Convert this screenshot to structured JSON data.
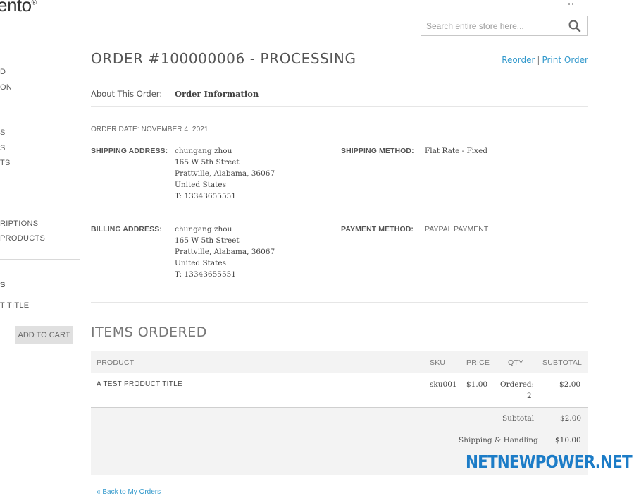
{
  "header": {
    "logo_text": "ento",
    "logo_mark": "®",
    "search": {
      "placeholder": "Search entire store here...",
      "icon": "search-icon"
    }
  },
  "sidebar": {
    "items_top": [
      "D",
      "ON"
    ],
    "items_mid": [
      "S",
      "S",
      "TS"
    ],
    "items_sub": [
      "RIPTIONS",
      "PRODUCTS"
    ],
    "recent_heading": "S",
    "recent_product": "T TITLE",
    "add_to_cart_label": "ADD TO CART"
  },
  "order": {
    "title": "ORDER #100000006 - PROCESSING",
    "reorder_label": "Reorder",
    "separator": "|",
    "print_label": "Print Order",
    "about_label": "About This Order:",
    "about_value": "Order Information",
    "order_date": "ORDER DATE: NOVEMBER 4, 2021",
    "shipping_address_label": "SHIPPING ADDRESS:",
    "shipping_address": [
      "chungang zhou",
      "165 W 5th Street",
      "Prattville, Alabama, 36067",
      "United States",
      "T: 13343655551"
    ],
    "shipping_method_label": "SHIPPING METHOD:",
    "shipping_method": "Flat Rate - Fixed",
    "billing_address_label": "BILLING ADDRESS:",
    "billing_address": [
      "chungang zhou",
      "165 W 5th Street",
      "Prattville, Alabama, 36067",
      "United States",
      "T: 13343655551"
    ],
    "payment_method_label": "PAYMENT METHOD:",
    "payment_method": "PAYPAL PAYMENT"
  },
  "items": {
    "title": "ITEMS ORDERED",
    "headers": {
      "product": "PRODUCT",
      "sku": "SKU",
      "price": "PRICE",
      "qty": "QTY",
      "subtotal": "SUBTOTAL"
    },
    "rows": [
      {
        "product": "A TEST PRODUCT TITLE",
        "sku": "sku001",
        "price": "$1.00",
        "qty_label": "Ordered:",
        "qty": "2",
        "subtotal": "$2.00"
      }
    ],
    "totals": {
      "subtotal_label": "Subtotal",
      "subtotal_value": "$2.00",
      "shipping_label": "Shipping & Handling",
      "shipping_value": "$10.00"
    }
  },
  "watermark": "NETNEWPOWER.NET",
  "footer": {
    "back_link": "« Back to My Orders"
  },
  "colors": {
    "link": "#3399cc",
    "watermark": "#1c7cc7"
  }
}
